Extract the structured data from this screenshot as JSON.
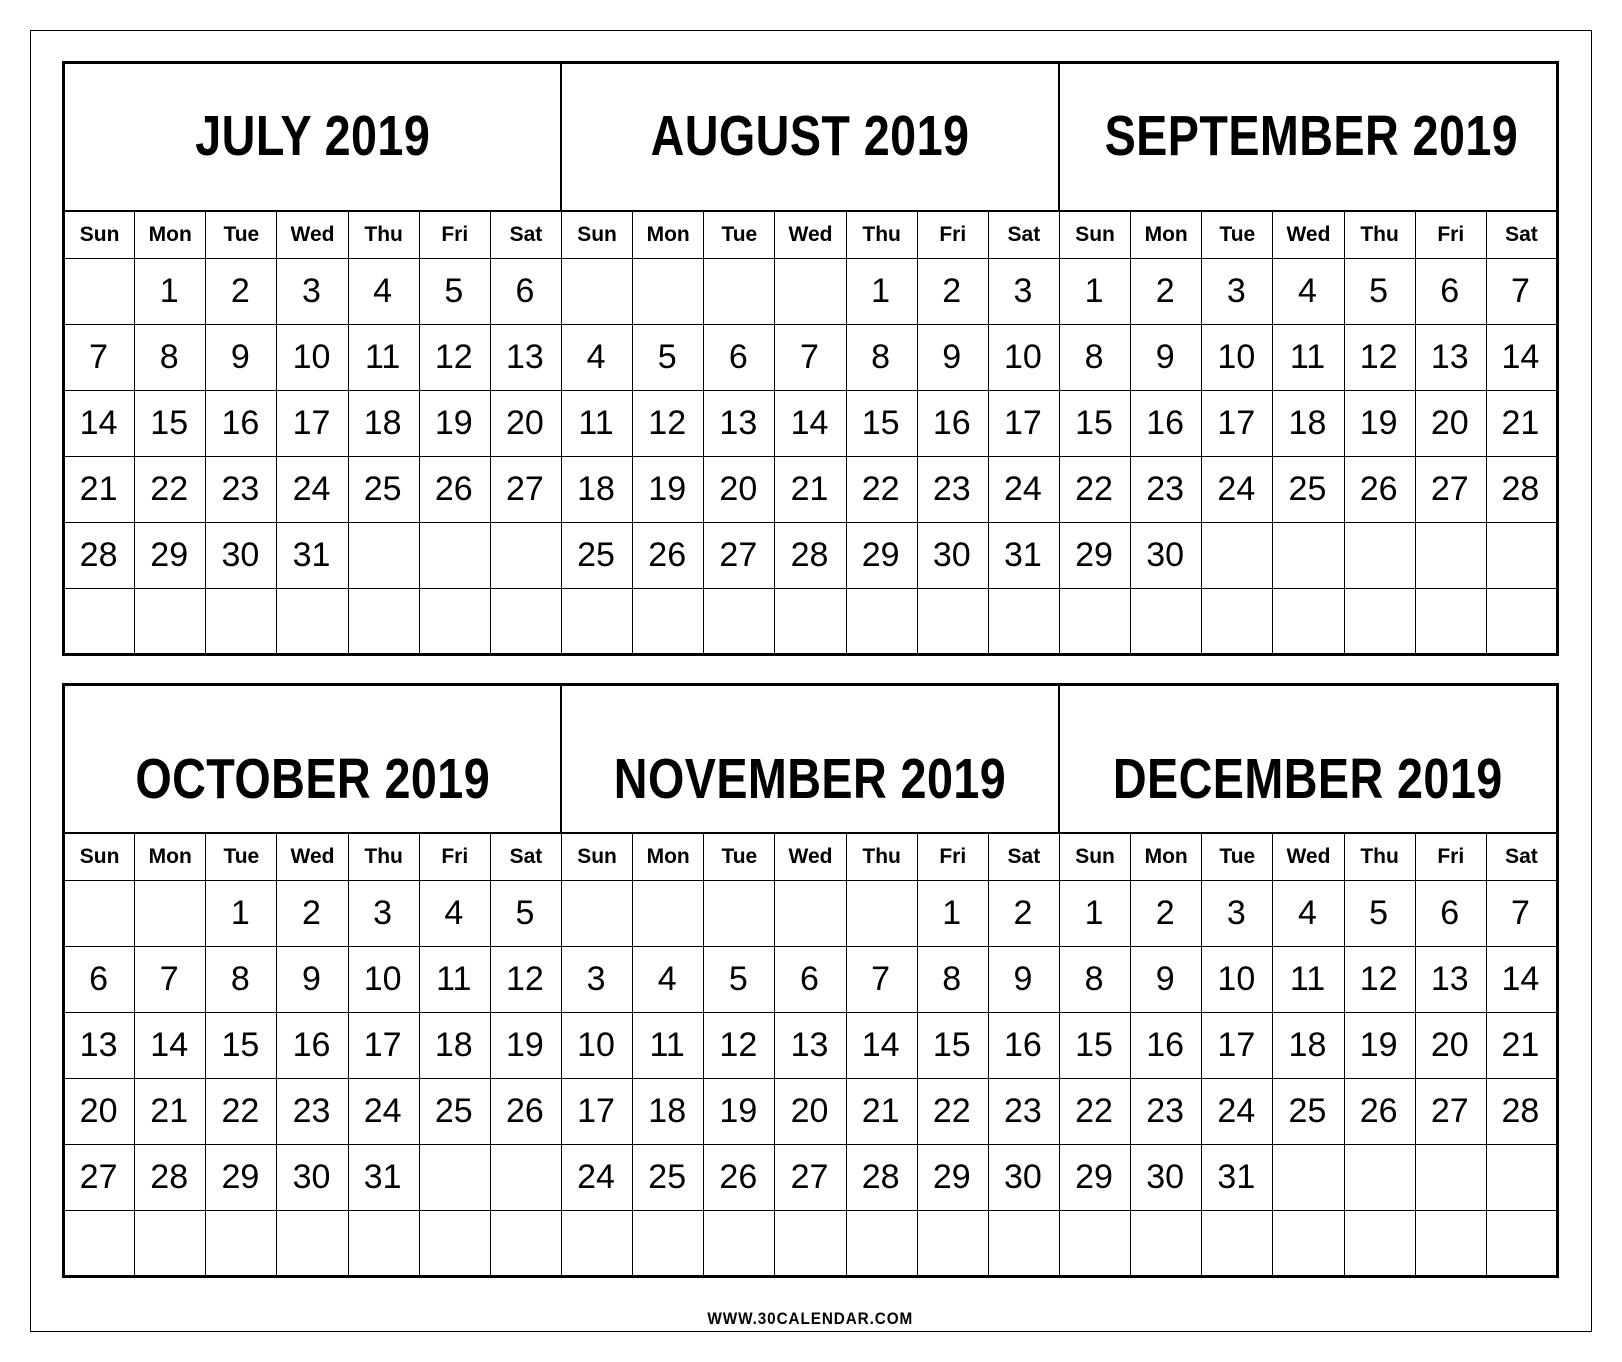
{
  "page": {
    "footer_url": "WWW.30CALENDAR.COM",
    "border_color": "#000000",
    "background_color": "#ffffff",
    "text_color": "#000000"
  },
  "weekday_headers": [
    "Sun",
    "Mon",
    "Tue",
    "Wed",
    "Thu",
    "Fri",
    "Sat"
  ],
  "blocks": [
    {
      "id": "block-top",
      "months": [
        {
          "id": "july",
          "title": "JULY 2019",
          "name": "July",
          "year": "2019",
          "first_weekday_index": 1,
          "days_in_month": 31,
          "weeks": [
            [
              "",
              "1",
              "2",
              "3",
              "4",
              "5",
              "6"
            ],
            [
              "7",
              "8",
              "9",
              "10",
              "11",
              "12",
              "13"
            ],
            [
              "14",
              "15",
              "16",
              "17",
              "18",
              "19",
              "20"
            ],
            [
              "21",
              "22",
              "23",
              "24",
              "25",
              "26",
              "27"
            ],
            [
              "28",
              "29",
              "30",
              "31",
              "",
              "",
              ""
            ],
            [
              "",
              "",
              "",
              "",
              "",
              "",
              ""
            ]
          ]
        },
        {
          "id": "august",
          "title": "AUGUST 2019",
          "name": "August",
          "year": "2019",
          "first_weekday_index": 4,
          "days_in_month": 31,
          "weeks": [
            [
              "",
              "",
              "",
              "",
              "1",
              "2",
              "3"
            ],
            [
              "4",
              "5",
              "6",
              "7",
              "8",
              "9",
              "10"
            ],
            [
              "11",
              "12",
              "13",
              "14",
              "15",
              "16",
              "17"
            ],
            [
              "18",
              "19",
              "20",
              "21",
              "22",
              "23",
              "24"
            ],
            [
              "25",
              "26",
              "27",
              "28",
              "29",
              "30",
              "31"
            ],
            [
              "",
              "",
              "",
              "",
              "",
              "",
              ""
            ]
          ]
        },
        {
          "id": "september",
          "title": "SEPTEMBER 2019",
          "name": "September",
          "year": "2019",
          "first_weekday_index": 0,
          "days_in_month": 30,
          "weeks": [
            [
              "1",
              "2",
              "3",
              "4",
              "5",
              "6",
              "7"
            ],
            [
              "8",
              "9",
              "10",
              "11",
              "12",
              "13",
              "14"
            ],
            [
              "15",
              "16",
              "17",
              "18",
              "19",
              "20",
              "21"
            ],
            [
              "22",
              "23",
              "24",
              "25",
              "26",
              "27",
              "28"
            ],
            [
              "29",
              "30",
              "",
              "",
              "",
              "",
              ""
            ],
            [
              "",
              "",
              "",
              "",
              "",
              "",
              ""
            ]
          ]
        }
      ]
    },
    {
      "id": "block-bottom",
      "months": [
        {
          "id": "october",
          "title": "OCTOBER 2019",
          "name": "October",
          "year": "2019",
          "first_weekday_index": 2,
          "days_in_month": 31,
          "weeks": [
            [
              "",
              "",
              "1",
              "2",
              "3",
              "4",
              "5"
            ],
            [
              "6",
              "7",
              "8",
              "9",
              "10",
              "11",
              "12"
            ],
            [
              "13",
              "14",
              "15",
              "16",
              "17",
              "18",
              "19"
            ],
            [
              "20",
              "21",
              "22",
              "23",
              "24",
              "25",
              "26"
            ],
            [
              "27",
              "28",
              "29",
              "30",
              "31",
              "",
              ""
            ],
            [
              "",
              "",
              "",
              "",
              "",
              "",
              ""
            ]
          ]
        },
        {
          "id": "november",
          "title": "NOVEMBER 2019",
          "name": "November",
          "year": "2019",
          "first_weekday_index": 5,
          "days_in_month": 30,
          "weeks": [
            [
              "",
              "",
              "",
              "",
              "",
              "1",
              "2"
            ],
            [
              "3",
              "4",
              "5",
              "6",
              "7",
              "8",
              "9"
            ],
            [
              "10",
              "11",
              "12",
              "13",
              "14",
              "15",
              "16"
            ],
            [
              "17",
              "18",
              "19",
              "20",
              "21",
              "22",
              "23"
            ],
            [
              "24",
              "25",
              "26",
              "27",
              "28",
              "29",
              "30"
            ],
            [
              "",
              "",
              "",
              "",
              "",
              "",
              ""
            ]
          ]
        },
        {
          "id": "december",
          "title": "DECEMBER 2019",
          "name": "December",
          "year": "2019",
          "first_weekday_index": 0,
          "days_in_month": 31,
          "weeks": [
            [
              "1",
              "2",
              "3",
              "4",
              "5",
              "6",
              "7"
            ],
            [
              "8",
              "9",
              "10",
              "11",
              "12",
              "13",
              "14"
            ],
            [
              "15",
              "16",
              "17",
              "18",
              "19",
              "20",
              "21"
            ],
            [
              "22",
              "23",
              "24",
              "25",
              "26",
              "27",
              "28"
            ],
            [
              "29",
              "30",
              "31",
              "",
              "",
              "",
              ""
            ],
            [
              "",
              "",
              "",
              "",
              "",
              "",
              ""
            ]
          ]
        }
      ]
    }
  ]
}
